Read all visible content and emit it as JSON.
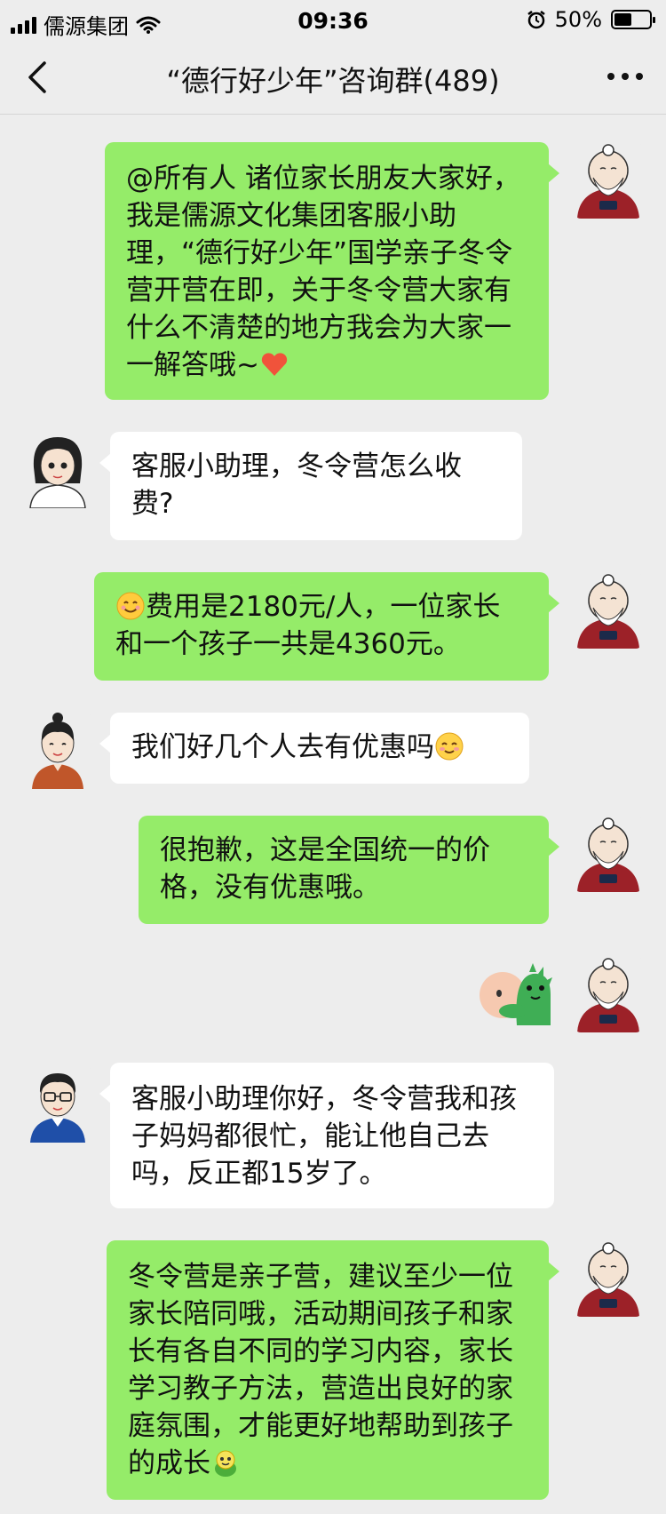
{
  "status_bar": {
    "carrier": "儒源集团",
    "time": "09:36",
    "battery": "50%",
    "battery_level": 0.5,
    "icons": [
      "signal-icon",
      "wifi-icon",
      "alarm-icon",
      "battery-icon"
    ]
  },
  "navbar": {
    "title": "“德行好少年”咨询群(489)",
    "back_icon": "chevron-left-icon",
    "more_icon": "more-dots-icon"
  },
  "colors": {
    "background": "#ededed",
    "sent_bubble": "#95ec69",
    "received_bubble": "#ffffff"
  },
  "messages": [
    {
      "side": "me",
      "text": "@所有人 诸位家长朋友大家好，我是儒源文化集团客服小助理，“德行好少年”国学亲子冬令营开营在即，关于冬令营大家有什么不清楚的地方我会为大家一一解答哦~",
      "emoji": "heart-icon"
    },
    {
      "side": "other",
      "text": "客服小助理，冬令营怎么收费?"
    },
    {
      "side": "me",
      "text": "费用是2180元/人，一位家长和一个孩子一共是4360元。",
      "emoji_before": "smile-emoji-icon"
    },
    {
      "side": "other",
      "text": "我们好几个人去有优惠吗",
      "emoji": "blush-emoji-icon"
    },
    {
      "side": "me",
      "text": "很抱歉，这是全国统一的价格，没有优惠哦。"
    },
    {
      "side": "me",
      "sticker": "dinosaur-hug-sticker"
    },
    {
      "side": "other",
      "text": "客服小助理你好，冬令营我和孩子妈妈都很忙，能让他自己去吗，反正都15岁了。"
    },
    {
      "side": "me",
      "text": "冬令营是亲子营，建议至少一位家长陪同哦，活动期间孩子和家长有各自不同的学习内容，家长学习教子方法，营造出良好的家庭氛围，才能更好地帮助到孩子的成长",
      "emoji": "frog-emoji-icon"
    }
  ]
}
